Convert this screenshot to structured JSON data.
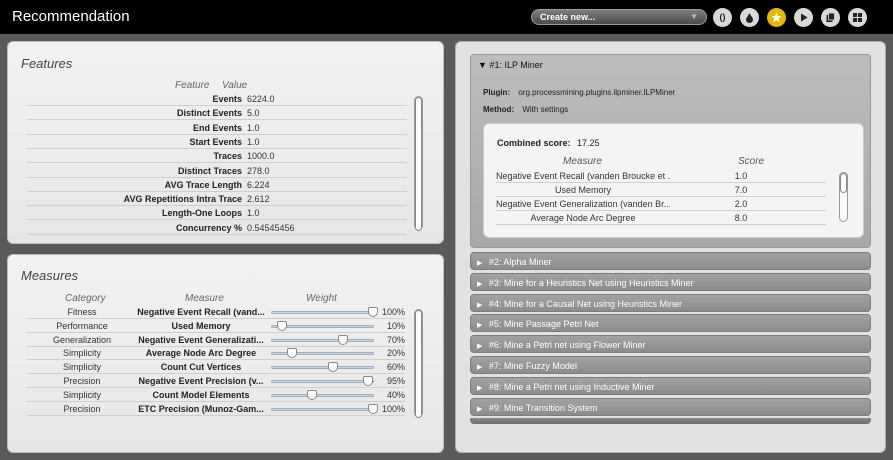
{
  "app": {
    "title": "Recommendation"
  },
  "toolbar": {
    "create_select_value": "Create new...",
    "buttons": [
      {
        "icon": "parentheses-icon",
        "label": "()"
      },
      {
        "icon": "drop-icon"
      },
      {
        "icon": "star-icon"
      },
      {
        "icon": "play-icon"
      },
      {
        "icon": "copy-icon"
      },
      {
        "icon": "grid-icon"
      }
    ]
  },
  "features": {
    "heading": "Features",
    "col_feature": "Feature",
    "col_value": "Value",
    "rows": [
      {
        "label": "Events",
        "value": "6224.0"
      },
      {
        "label": "Distinct Events",
        "value": "5.0"
      },
      {
        "label": "End Events",
        "value": "1.0"
      },
      {
        "label": "Start Events",
        "value": "1.0"
      },
      {
        "label": "Traces",
        "value": "1000.0"
      },
      {
        "label": "Distinct Traces",
        "value": "278.0"
      },
      {
        "label": "AVG Trace Length",
        "value": "6.224"
      },
      {
        "label": "AVG Repetitions Intra Trace",
        "value": "2.612"
      },
      {
        "label": "Length-One Loops",
        "value": "1.0"
      },
      {
        "label": "Concurrency %",
        "value": "0.54545456"
      }
    ]
  },
  "measures": {
    "heading": "Measures",
    "col_category": "Category",
    "col_measure": "Measure",
    "col_weight": "Weight",
    "rows": [
      {
        "category": "Fitness",
        "measure": "Negative Event Recall (vand...",
        "weight": 100,
        "pct": "100%"
      },
      {
        "category": "Performance",
        "measure": "Used Memory",
        "weight": 10,
        "pct": "10%"
      },
      {
        "category": "Generalization",
        "measure": "Negative Event Generalizati...",
        "weight": 70,
        "pct": "70%"
      },
      {
        "category": "Simplicity",
        "measure": "Average Node Arc Degree",
        "weight": 20,
        "pct": "20%"
      },
      {
        "category": "Simplicity",
        "measure": "Count Cut Vertices",
        "weight": 60,
        "pct": "60%"
      },
      {
        "category": "Precision",
        "measure": "Negative Event Precision (v...",
        "weight": 95,
        "pct": "95%"
      },
      {
        "category": "Simplicity",
        "measure": "Count Model Elements",
        "weight": 40,
        "pct": "40%"
      },
      {
        "category": "Precision",
        "measure": "ETC Precision (Munoz-Gam...",
        "weight": 100,
        "pct": "100%"
      }
    ]
  },
  "results": {
    "expanded": {
      "title": "#1: ILP Miner",
      "plugin_label": "Plugin:",
      "plugin_value": "org.processmining.plugins.ilpminer.ILPMiner",
      "method_label": "Method:",
      "method_value": "With settings",
      "combined_label": "Combined score:",
      "combined_value": "17.25",
      "col_measure": "Measure",
      "col_score": "Score",
      "scores": [
        {
          "measure": "Negative Event Recall (vanden Broucke et ...",
          "score": "1.0"
        },
        {
          "measure": "Used Memory",
          "score": "7.0"
        },
        {
          "measure": "Negative Event Generalization (vanden Br...",
          "score": "2.0"
        },
        {
          "measure": "Average Node Arc Degree",
          "score": "8.0"
        }
      ]
    },
    "collapsed": [
      "#2: Alpha Miner",
      "#3: Mine for a Heuristics Net using Heuristics Miner",
      "#4: Mine for a Causal Net using Heuristics Miner",
      "#5: Mine Passage Petri Net",
      "#6: Mine a Petri net using Flower Miner",
      "#7: Mine Fuzzy Model",
      "#8: Mine a Petri net using Inductive Miner",
      "#9: Mine Transition System"
    ]
  }
}
